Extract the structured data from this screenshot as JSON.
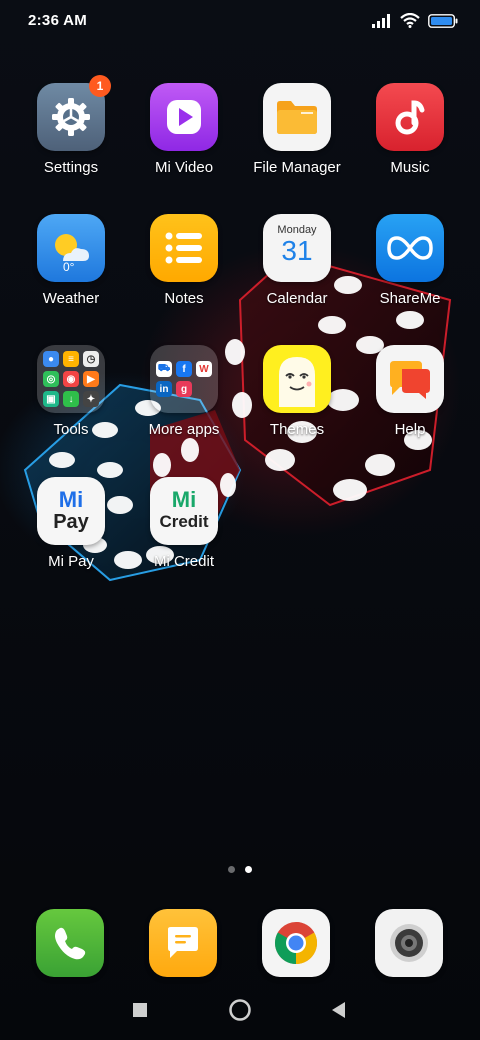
{
  "status_bar": {
    "time": "2:36 AM"
  },
  "apps": {
    "settings": {
      "label": "Settings",
      "badge": "1"
    },
    "mi_video": {
      "label": "Mi Video"
    },
    "file_manager": {
      "label": "File Manager"
    },
    "music": {
      "label": "Music"
    },
    "weather": {
      "label": "Weather",
      "temp": "0°"
    },
    "notes": {
      "label": "Notes"
    },
    "calendar": {
      "label": "Calendar",
      "day": "Monday",
      "date": "31"
    },
    "shareme": {
      "label": "ShareMe"
    },
    "tools": {
      "label": "Tools"
    },
    "more_apps": {
      "label": "More apps"
    },
    "themes": {
      "label": "Themes"
    },
    "help": {
      "label": "Help"
    },
    "mi_pay": {
      "label": "Mi Pay",
      "logo_line1": "Mi",
      "logo_line2": "Pay"
    },
    "mi_credit": {
      "label": "Mi Credit",
      "logo_line1": "Mi",
      "logo_line2": "Credit"
    }
  },
  "dock": [
    "phone-icon",
    "messaging-icon",
    "chrome-icon",
    "camera-icon"
  ],
  "pages": {
    "total": 2,
    "current": 2
  },
  "colors": {
    "settings": "#5a6f86",
    "mi_video": "#a23cf0",
    "music": "#e9323d",
    "weather": "#2b8ae8",
    "notes": "#ffb300",
    "shareme": "#1689e8",
    "phone": "#3fb34a",
    "messaging": "#ffb21a",
    "badge": "#ff5a1f"
  }
}
